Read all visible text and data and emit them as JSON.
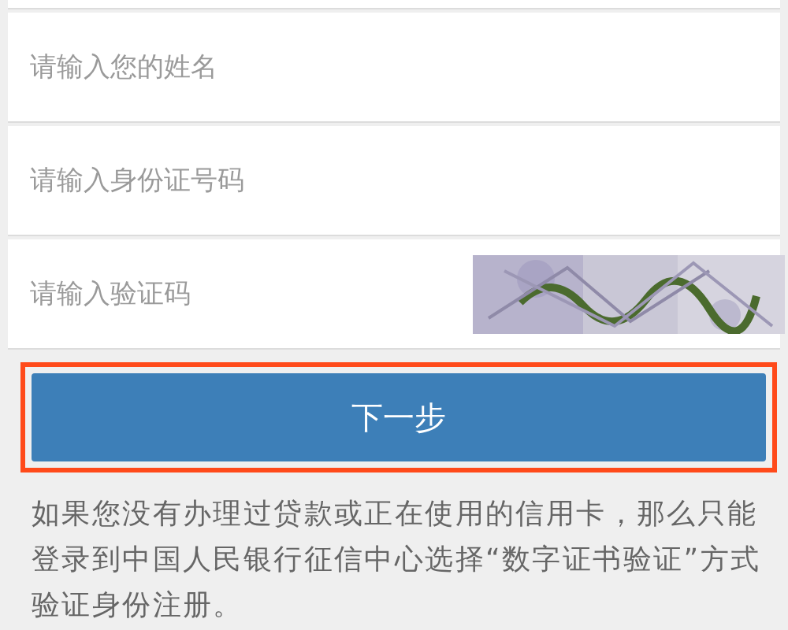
{
  "fields": [
    {
      "placeholder": "请输入您的姓名",
      "kind": "text"
    },
    {
      "placeholder": "请输入身份证号码",
      "kind": "text"
    },
    {
      "placeholder": "请输入验证码",
      "kind": "captcha"
    }
  ],
  "button": {
    "label": "下一步",
    "highlighted": true
  },
  "note": "如果您没有办理过贷款或正在使用的信用卡，那么只能登录到中国人民银行征信中心选择“数字证书验证”方式验证身份注册。"
}
